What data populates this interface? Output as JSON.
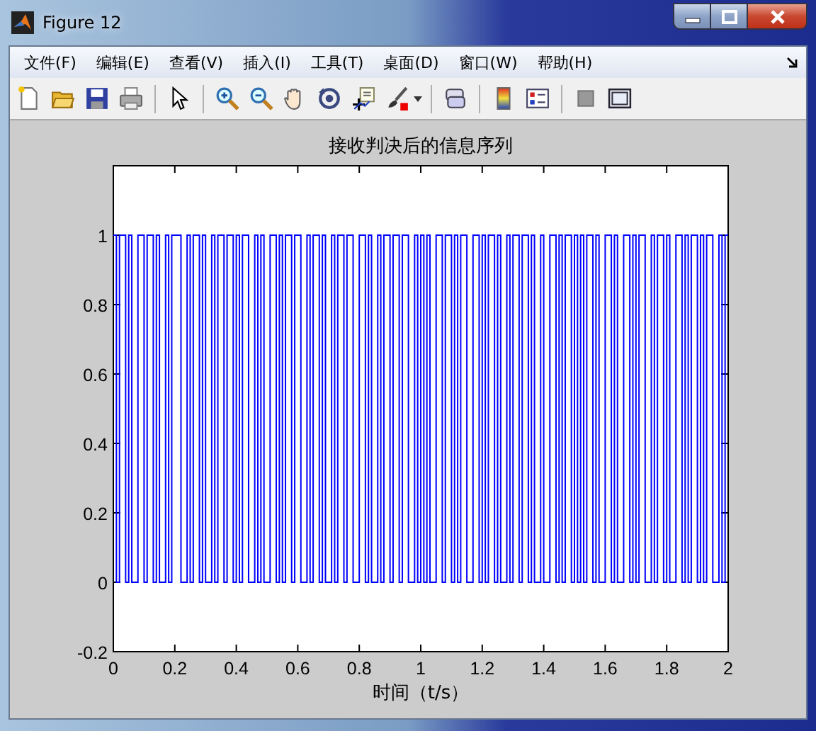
{
  "window": {
    "title": "Figure 12"
  },
  "menu": [
    "文件(F)",
    "编辑(E)",
    "查看(V)",
    "插入(I)",
    "工具(T)",
    "桌面(D)",
    "窗口(W)",
    "帮助(H)"
  ],
  "plot": {
    "chart_data": {
      "type": "line",
      "title": "接收判决后的信息序列",
      "xlabel": "时间（t/s）",
      "x": [
        0,
        0.01,
        0.02,
        0.03,
        0.04,
        0.05,
        0.06,
        0.07,
        0.08,
        0.09,
        0.1,
        0.11,
        0.12,
        0.13,
        0.14,
        0.15,
        0.16,
        0.17,
        0.18,
        0.19,
        0.2,
        0.21,
        0.22,
        0.23,
        0.24,
        0.25,
        0.26,
        0.27,
        0.28,
        0.29,
        0.3,
        0.31,
        0.32,
        0.33,
        0.34,
        0.35,
        0.36,
        0.37,
        0.38,
        0.39,
        0.4,
        0.41,
        0.42,
        0.43,
        0.44,
        0.45,
        0.46,
        0.47,
        0.48,
        0.49,
        0.5,
        0.51,
        0.52,
        0.53,
        0.54,
        0.55,
        0.56,
        0.57,
        0.58,
        0.59,
        0.6,
        0.61,
        0.62,
        0.63,
        0.64,
        0.65,
        0.66,
        0.67,
        0.68,
        0.69,
        0.7,
        0.71,
        0.72,
        0.73,
        0.74,
        0.75,
        0.76,
        0.77,
        0.78,
        0.79,
        0.8,
        0.81,
        0.82,
        0.83,
        0.84,
        0.85,
        0.86,
        0.87,
        0.88,
        0.89,
        0.9,
        0.91,
        0.92,
        0.93,
        0.94,
        0.95,
        0.96,
        0.97,
        0.98,
        0.99,
        1,
        1.01,
        1.02,
        1.03,
        1.04,
        1.05,
        1.06,
        1.07,
        1.08,
        1.09,
        1.1,
        1.11,
        1.12,
        1.13,
        1.14,
        1.15,
        1.16,
        1.17,
        1.18,
        1.19,
        1.2,
        1.21,
        1.22,
        1.23,
        1.24,
        1.25,
        1.26,
        1.27,
        1.28,
        1.29,
        1.3,
        1.31,
        1.32,
        1.33,
        1.34,
        1.35,
        1.36,
        1.37,
        1.38,
        1.39,
        1.4,
        1.41,
        1.42,
        1.43,
        1.44,
        1.45,
        1.46,
        1.47,
        1.48,
        1.49,
        1.5,
        1.51,
        1.52,
        1.53,
        1.54,
        1.55,
        1.56,
        1.57,
        1.58,
        1.59,
        1.6,
        1.61,
        1.62,
        1.63,
        1.64,
        1.65,
        1.66,
        1.67,
        1.68,
        1.69,
        1.7,
        1.71,
        1.72,
        1.73,
        1.74,
        1.75,
        1.76,
        1.77,
        1.78,
        1.79,
        1.8,
        1.81,
        1.82,
        1.83,
        1.84,
        1.85,
        1.86,
        1.87,
        1.88,
        1.89,
        1.9,
        1.91,
        1.92,
        1.93,
        1.94,
        1.95,
        1.96,
        1.97,
        1.98,
        1.99
      ],
      "xlim": [
        0,
        2
      ],
      "ylim": [
        -0.2,
        1.2
      ],
      "xticks": [
        0,
        0.2,
        0.4,
        0.6,
        0.8,
        1,
        1.2,
        1.4,
        1.6,
        1.8,
        2
      ],
      "yticks": [
        -0.2,
        0,
        0.2,
        0.4,
        0.6,
        0.8,
        1
      ],
      "series": [
        {
          "color": "#0000ff",
          "values": [
            1,
            0,
            1,
            1,
            0,
            1,
            0,
            0,
            1,
            1,
            0,
            1,
            1,
            0,
            1,
            0,
            0,
            1,
            0,
            1,
            1,
            1,
            0,
            0,
            1,
            0,
            1,
            1,
            0,
            1,
            0,
            0,
            1,
            0,
            1,
            1,
            0,
            1,
            1,
            0,
            1,
            0,
            1,
            1,
            0,
            0,
            1,
            0,
            1,
            0,
            0,
            1,
            1,
            0,
            1,
            0,
            1,
            1,
            0,
            1,
            1,
            0,
            0,
            1,
            0,
            1,
            1,
            0,
            1,
            0,
            0,
            1,
            0,
            1,
            1,
            0,
            1,
            1,
            0,
            0,
            1,
            1,
            0,
            1,
            0,
            0,
            1,
            0,
            1,
            1,
            0,
            1,
            1,
            0,
            1,
            1,
            0,
            0,
            1,
            0,
            1,
            0,
            1,
            0,
            0,
            1,
            1,
            0,
            1,
            1,
            0,
            1,
            0,
            1,
            1,
            0,
            0,
            1,
            1,
            0,
            1,
            0,
            1,
            1,
            0,
            1,
            0,
            0,
            1,
            0,
            1,
            1,
            0,
            1,
            1,
            0,
            1,
            0,
            0,
            1,
            0,
            0,
            1,
            1,
            0,
            1,
            0,
            1,
            1,
            0,
            1,
            0,
            1,
            0,
            1,
            1,
            0,
            1,
            0,
            0,
            1,
            1,
            0,
            1,
            0,
            0,
            1,
            1,
            0,
            1,
            0,
            1,
            1,
            0,
            0,
            1,
            0,
            1,
            1,
            0,
            1,
            0,
            0,
            1,
            1,
            0,
            1,
            0,
            1,
            1,
            0,
            1,
            0,
            1,
            1,
            0,
            0,
            1,
            0,
            1
          ]
        }
      ]
    }
  }
}
